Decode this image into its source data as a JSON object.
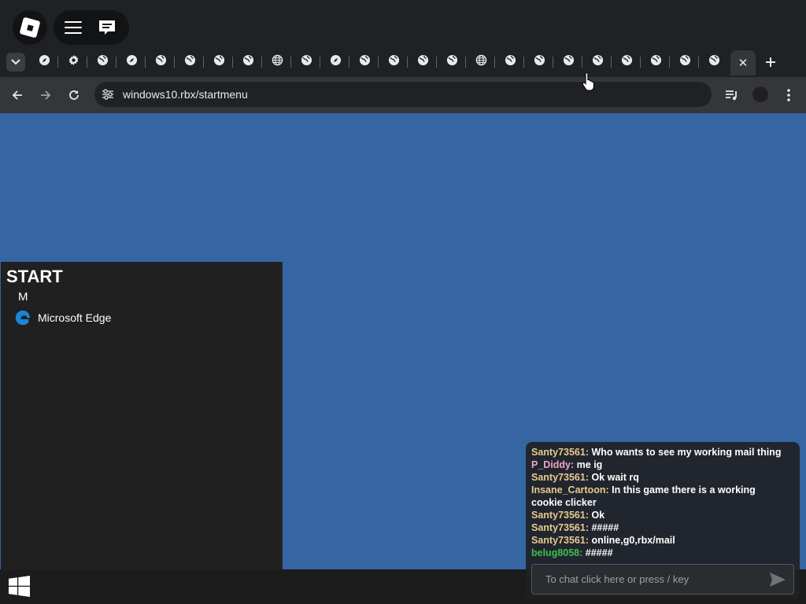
{
  "browser": {
    "url": "windows10.rbx/startmenu",
    "tabs": [
      {
        "icon": "compass-icon"
      },
      {
        "icon": "gear-icon"
      },
      {
        "icon": "globe-icon"
      },
      {
        "icon": "compass-icon"
      },
      {
        "icon": "globe-icon"
      },
      {
        "icon": "globe-icon"
      },
      {
        "icon": "globe-icon"
      },
      {
        "icon": "globe-icon"
      },
      {
        "icon": "web-icon"
      },
      {
        "icon": "globe-icon"
      },
      {
        "icon": "compass-icon"
      },
      {
        "icon": "globe-icon"
      },
      {
        "icon": "globe-icon"
      },
      {
        "icon": "globe-icon"
      },
      {
        "icon": "globe-icon"
      },
      {
        "icon": "web-icon"
      },
      {
        "icon": "globe-icon"
      },
      {
        "icon": "globe-icon"
      },
      {
        "icon": "globe-icon"
      },
      {
        "icon": "globe-icon"
      },
      {
        "icon": "globe-icon"
      },
      {
        "icon": "globe-icon"
      },
      {
        "icon": "globe-icon"
      },
      {
        "icon": "globe-icon"
      }
    ],
    "active_tab_close": "✕",
    "new_tab": "+"
  },
  "desktop": {
    "background": "#3565a3"
  },
  "start_menu": {
    "title": "START",
    "group_letter": "M",
    "apps": [
      {
        "label": "Microsoft Edge",
        "icon": "edge-icon"
      }
    ]
  },
  "chat": {
    "messages": [
      {
        "user": "Santy73561",
        "color": "#e6c98f",
        "text": "Who wants to see my working mail thing"
      },
      {
        "user": "P_Diddy",
        "color": "#f0a3c8",
        "text": "me ig"
      },
      {
        "user": "Santy73561",
        "color": "#e6c98f",
        "text": "Ok wait rq"
      },
      {
        "user": "Insane_Cartoon",
        "color": "#e6c98f",
        "text": "In this game there is a working cookie clicker"
      },
      {
        "user": "Santy73561",
        "color": "#e6c98f",
        "text": "Ok"
      },
      {
        "user": "Santy73561",
        "color": "#e6c98f",
        "text": "#####"
      },
      {
        "user": "Santy73561",
        "color": "#e6c98f",
        "text": "online,g0,rbx/mail"
      },
      {
        "user": "belug8058",
        "color": "#3fbf4f",
        "text": "#####"
      }
    ],
    "input_placeholder": "To chat click here or press / key"
  }
}
